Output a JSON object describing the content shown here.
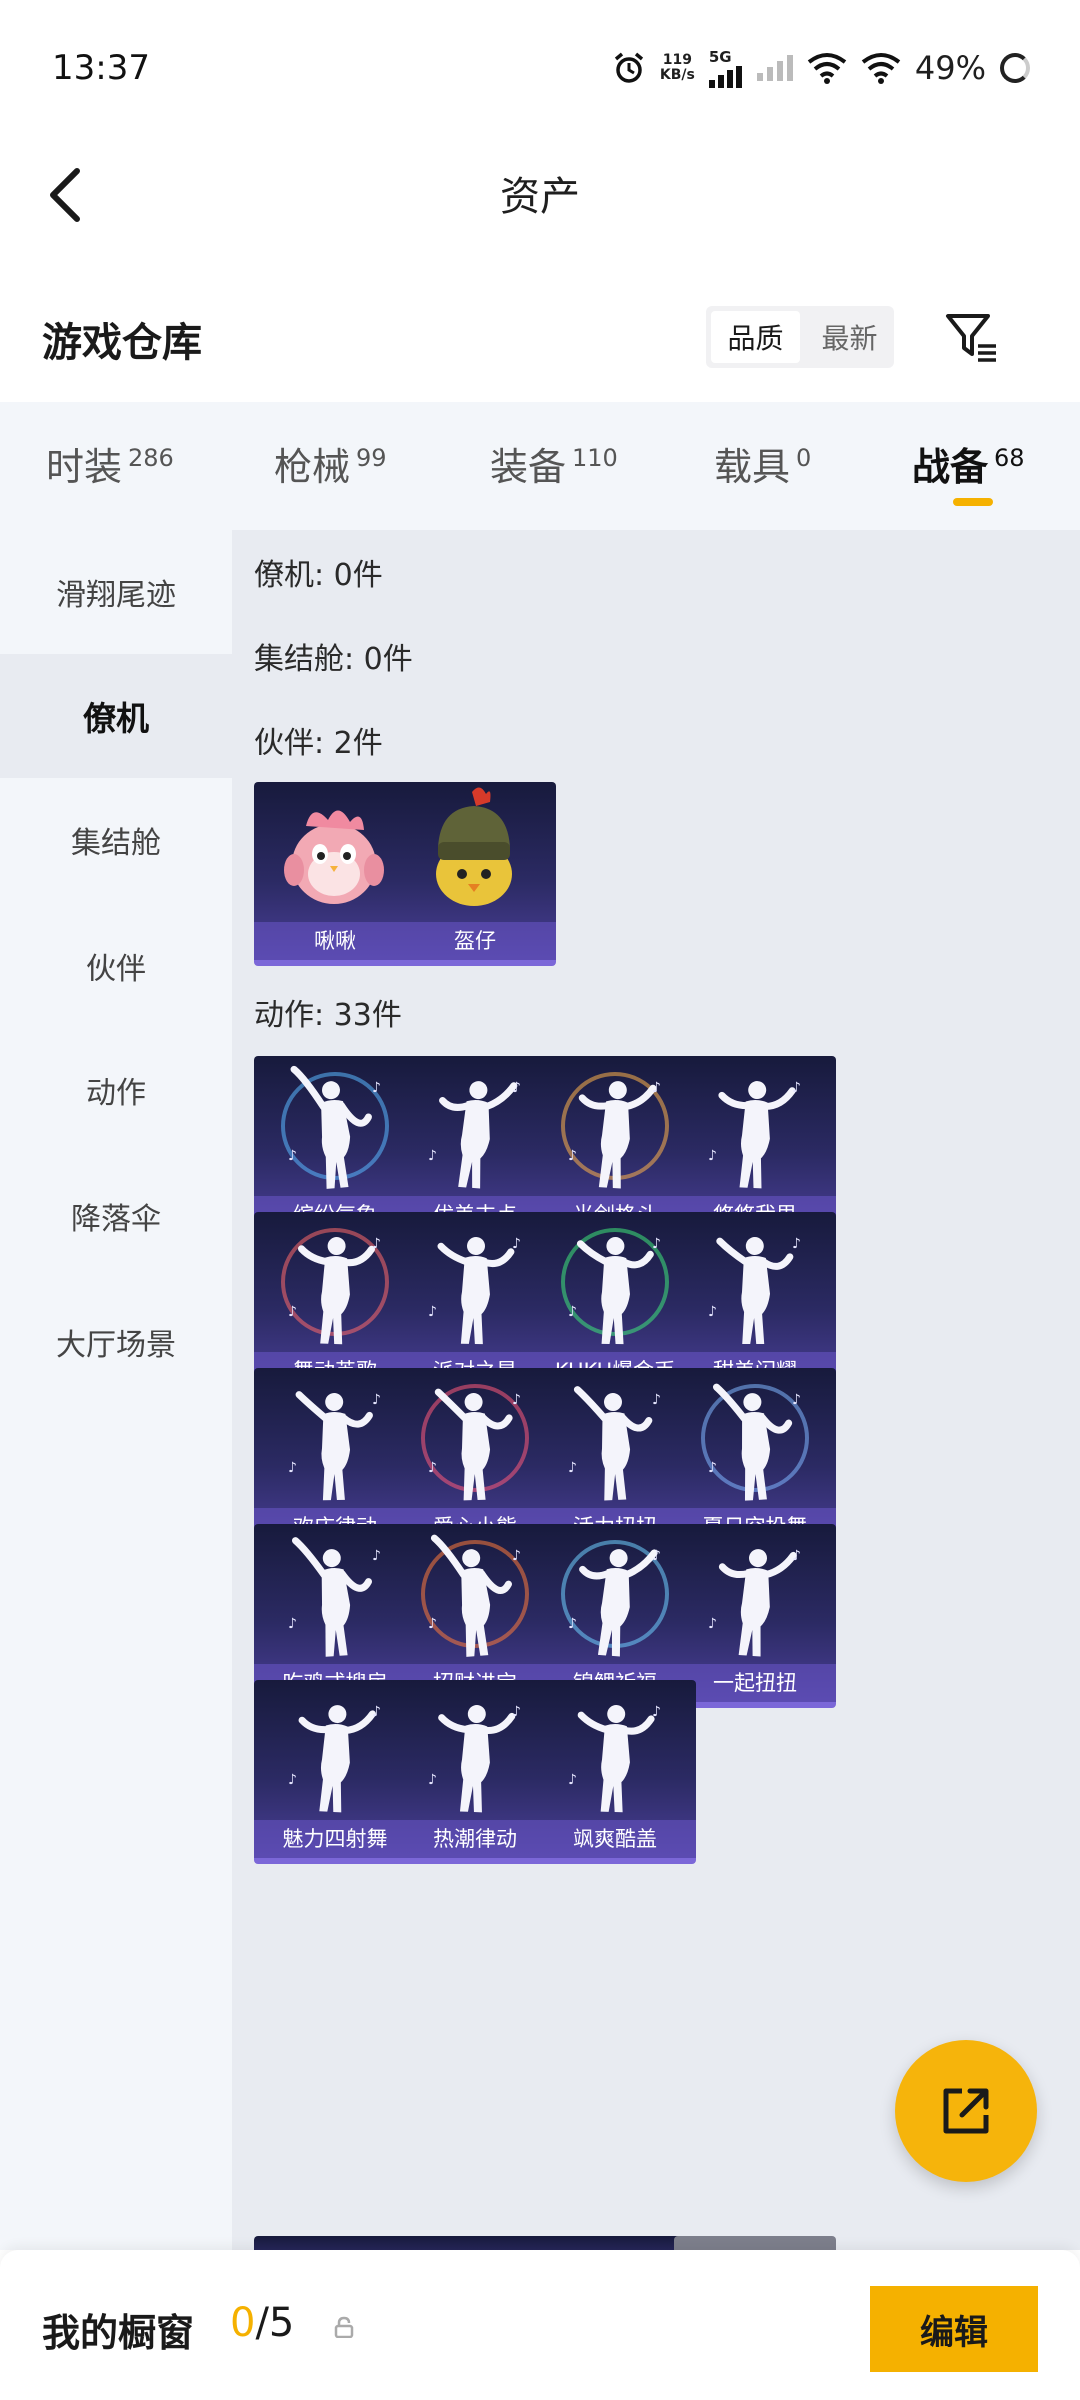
{
  "status_bar": {
    "time": "13:37",
    "speed_value": "119",
    "speed_unit": "KB/s",
    "network": "5G",
    "battery": "49%"
  },
  "header": {
    "title": "资产"
  },
  "warehouse": {
    "title": "游戏仓库",
    "sort_quality": "品质",
    "sort_latest": "最新"
  },
  "tabs": [
    {
      "label": "时装",
      "count": "286"
    },
    {
      "label": "枪械",
      "count": "99"
    },
    {
      "label": "装备",
      "count": "110"
    },
    {
      "label": "载具",
      "count": "0"
    },
    {
      "label": "战备",
      "count": "68"
    }
  ],
  "sidebar": [
    "滑翔尾迹",
    "僚机",
    "集结舱",
    "伙伴",
    "动作",
    "降落伞",
    "大厅场景"
  ],
  "groups": {
    "wingman": "僚机: 0件",
    "pod": "集结舱: 0件",
    "partner": "伙伴: 2件",
    "emote": "动作: 33件"
  },
  "partners": [
    "啾啾",
    "盔仔"
  ],
  "emotes": [
    "缤纷气象",
    "优美支点",
    "光剑格斗",
    "悠悠我思",
    "舞动英歌",
    "派对之星",
    "KUKU爆金币",
    "甜美闪耀",
    "欢庆律动",
    "爱心小熊",
    "活力扭扭",
    "夏日空投舞",
    "吃鸡式搜房",
    "招财进宝",
    "锦鲤祈福",
    "一起扭扭",
    "魅力四射舞",
    "热潮律动",
    "飒爽酷盖"
  ],
  "bottom": {
    "label": "我的橱窗",
    "current": "0",
    "max": "/5",
    "edit": "编辑"
  },
  "colors": {
    "accent": "#f5b100",
    "card_top": "#171a3c",
    "card_bottom": "#4a3f97"
  }
}
